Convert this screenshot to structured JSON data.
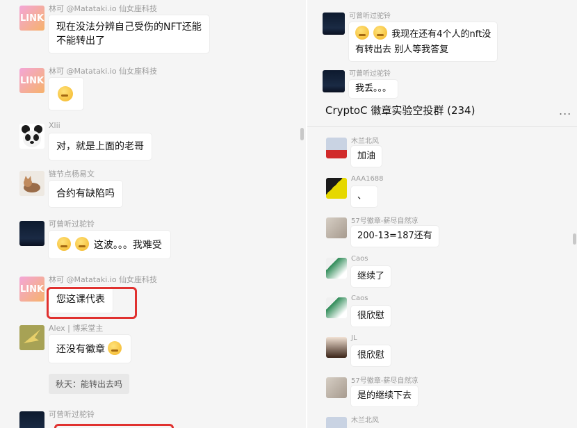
{
  "left_chat": {
    "messages": [
      {
        "sender": "林可 @Matataki.io 仙女座科技",
        "text": "现在没法分辨自己受伤的NFT还能",
        "text2": "不能转出了",
        "avatar": "link-logo"
      },
      {
        "sender": "林可 @Matataki.io 仙女座科技",
        "text": "",
        "avatar": "link-logo",
        "emoji": "laugh-cry-emoji"
      },
      {
        "sender": "Xlii",
        "text": "对，就是上面的老哥",
        "avatar": "panda"
      },
      {
        "sender": "链节点杨易文",
        "text": "合约有缺陷吗",
        "avatar": "cat"
      },
      {
        "sender": "可曾听过驼铃",
        "text": "这波。。。我难受",
        "avatar": "night-scene"
      },
      {
        "sender": "林可 @Matataki.io 仙女座科技",
        "text": "您这课代表",
        "avatar": "link-logo"
      },
      {
        "sender": "Alex | 博采堂主",
        "text": "还没有徽章",
        "avatar": "bird",
        "quote": "秋天：能转出去吗"
      },
      {
        "sender": "可曾听过驼铃",
        "text": "",
        "avatar": "night-scene"
      }
    ],
    "avatar_logo_text": "LINK"
  },
  "right_chat": {
    "top_messages": [
      {
        "sender": "可曾听过驼铃",
        "text": "我现在还有4个人的nft没",
        "text2": "有转出去 别人等我答复"
      },
      {
        "sender": "可曾听过驼铃",
        "text": "我丢。。。"
      }
    ],
    "group_title": "CryptoC 徽章实验空投群 (234)",
    "more_label": "...",
    "messages": [
      {
        "sender": "木兰北风",
        "text": "加油"
      },
      {
        "sender": "AAA1688",
        "text": "、"
      },
      {
        "sender": "57号徽章-薪尽自然凉",
        "text": "200-13=187还有"
      },
      {
        "sender": "Caos",
        "text": "继续了"
      },
      {
        "sender": "Caos",
        "text": "很欣慰"
      },
      {
        "sender": "JL",
        "text": "很欣慰"
      },
      {
        "sender": "57号徽章-薪尽自然凉",
        "text": "是的继续下去"
      },
      {
        "sender": "木兰北风",
        "text": ""
      }
    ]
  },
  "colors": {
    "highlight": "#e0312f",
    "background": "#f5f5f5",
    "bubble": "#ffffff",
    "sender": "#9b9b9b"
  }
}
